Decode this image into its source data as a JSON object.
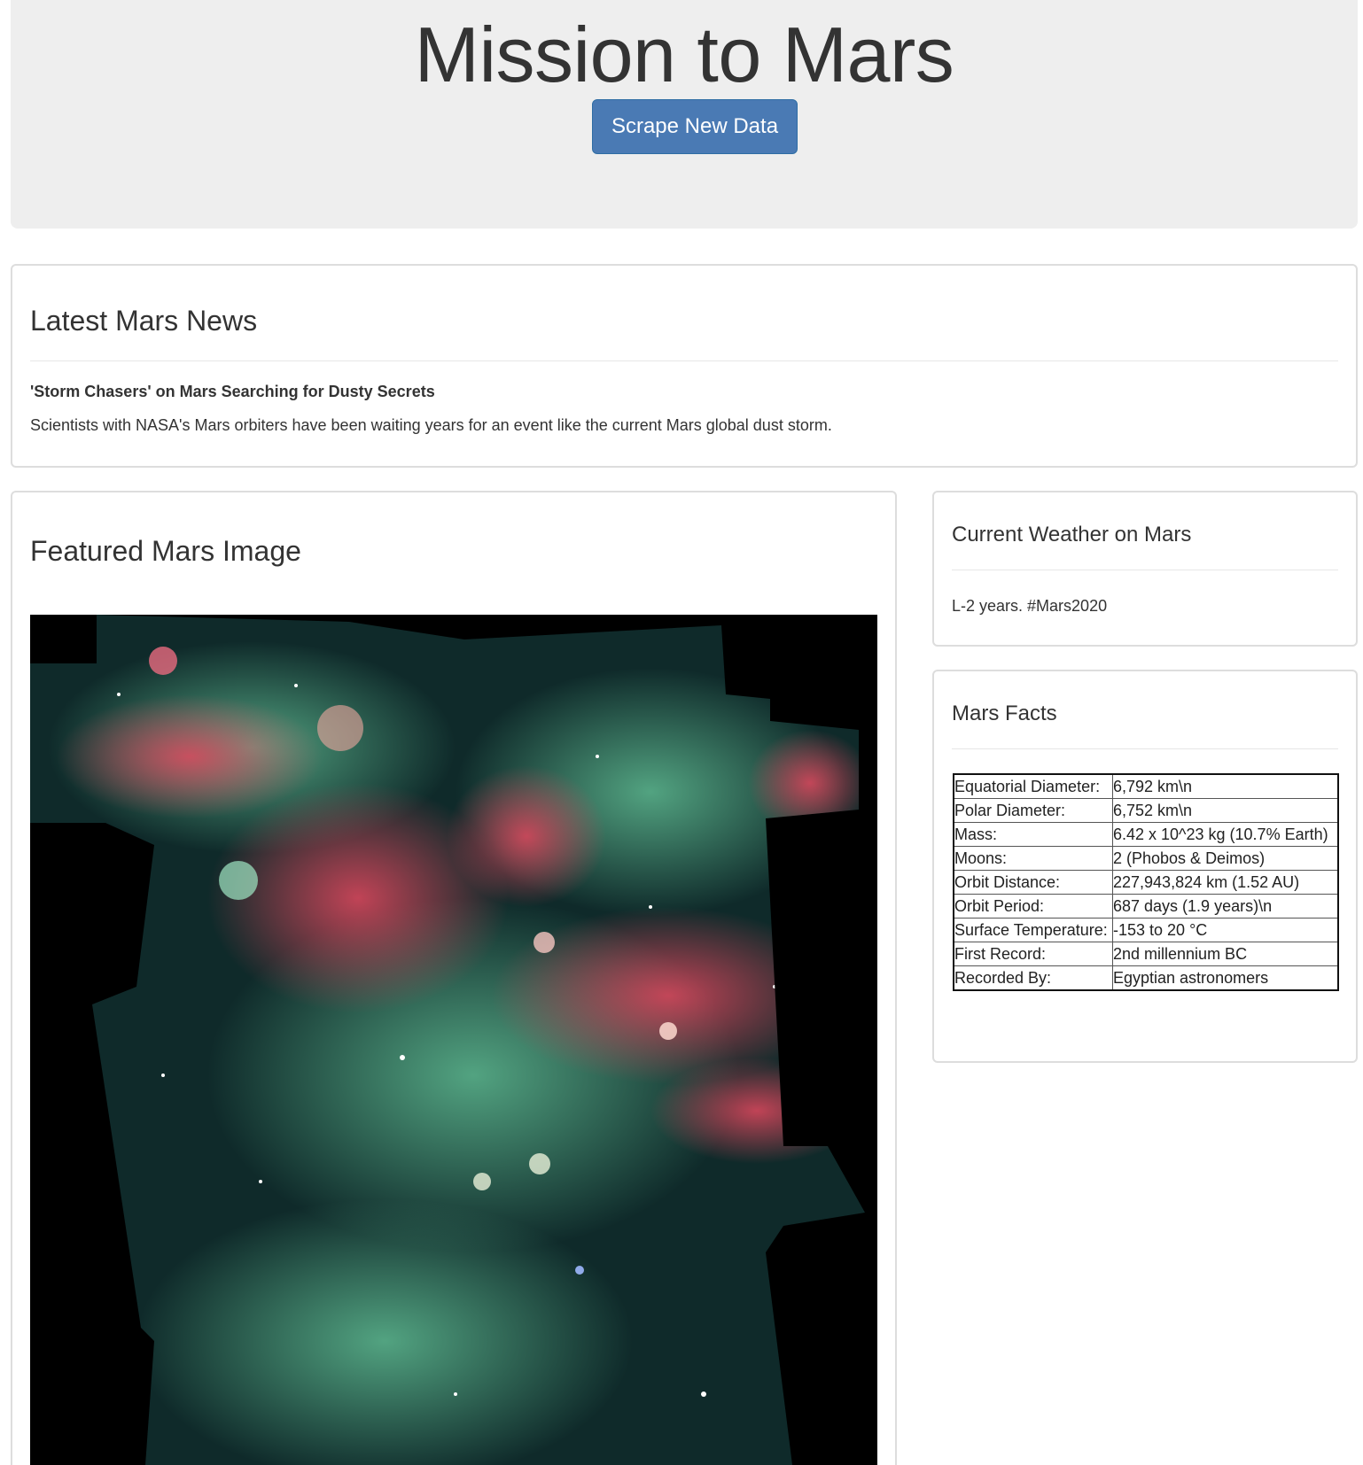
{
  "header": {
    "title": "Mission to Mars",
    "scrape_button": "Scrape New Data"
  },
  "news": {
    "heading": "Latest Mars News",
    "title": "'Storm Chasers' on Mars Searching for Dusty Secrets",
    "body": "Scientists with NASA's Mars orbiters have been waiting years for an event like the current Mars global dust storm."
  },
  "featured_image": {
    "heading": "Featured Mars Image"
  },
  "weather": {
    "heading": "Current Weather on Mars",
    "text": "L-2 years. #Mars2020"
  },
  "facts": {
    "heading": "Mars Facts",
    "rows": [
      {
        "label": "Equatorial Diameter:",
        "value": "6,792 km\\n"
      },
      {
        "label": "Polar Diameter:",
        "value": "6,752 km\\n"
      },
      {
        "label": "Mass:",
        "value": "6.42 x 10^23 kg (10.7% Earth)"
      },
      {
        "label": "Moons:",
        "value": "2 (Phobos & Deimos)"
      },
      {
        "label": "Orbit Distance:",
        "value": "227,943,824 km (1.52 AU)"
      },
      {
        "label": "Orbit Period:",
        "value": "687 days (1.9 years)\\n"
      },
      {
        "label": "Surface Temperature:",
        "value": "-153 to 20 °C"
      },
      {
        "label": "First Record:",
        "value": "2nd millennium BC"
      },
      {
        "label": "Recorded By:",
        "value": "Egyptian astronomers"
      }
    ]
  }
}
